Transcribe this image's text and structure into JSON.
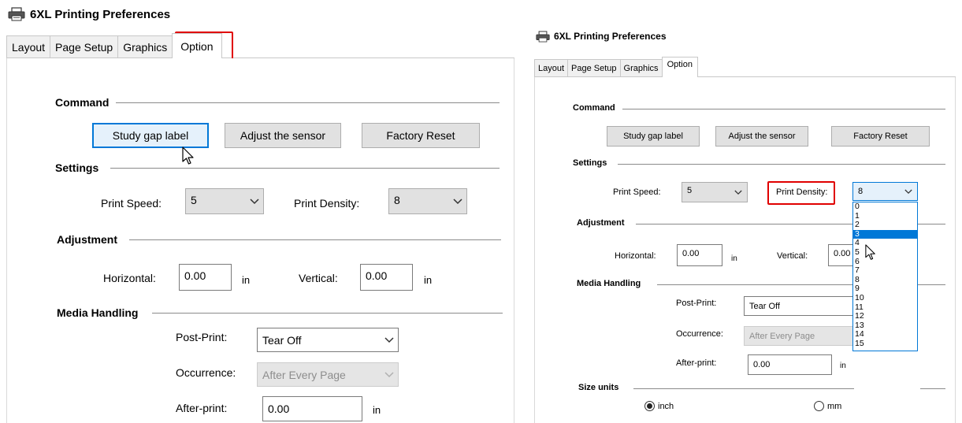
{
  "left_window": {
    "title": "6XL Printing Preferences",
    "tabs": [
      "Layout",
      "Page Setup",
      "Graphics",
      "Option"
    ],
    "active_tab": "Option",
    "command": {
      "section": "Command",
      "study_gap_label": "Study gap label",
      "adjust_sensor": "Adjust the sensor",
      "factory_reset": "Factory Reset"
    },
    "settings": {
      "section": "Settings",
      "print_speed_label": "Print Speed:",
      "print_speed_value": "5",
      "print_density_label": "Print Density:",
      "print_density_value": "8"
    },
    "adjustment": {
      "section": "Adjustment",
      "horizontal_label": "Horizontal:",
      "horizontal_value": "0.00",
      "horizontal_unit": "in",
      "vertical_label": "Vertical:",
      "vertical_value": "0.00",
      "vertical_unit": "in"
    },
    "media": {
      "section": "Media Handling",
      "post_print_label": "Post-Print:",
      "post_print_value": "Tear Off",
      "occurrence_label": "Occurrence:",
      "occurrence_value": "After Every Page",
      "after_print_label": "After-print:",
      "after_print_value": "0.00",
      "after_print_unit": "in"
    }
  },
  "right_window": {
    "title": "6XL Printing Preferences",
    "tabs": [
      "Layout",
      "Page Setup",
      "Graphics",
      "Option"
    ],
    "active_tab": "Option",
    "command": {
      "section": "Command",
      "study_gap_label": "Study gap label",
      "adjust_sensor": "Adjust the sensor",
      "factory_reset": "Factory Reset"
    },
    "settings": {
      "section": "Settings",
      "print_speed_label": "Print Speed:",
      "print_speed_value": "5",
      "print_density_label": "Print Density:",
      "print_density_value": "8",
      "density_options": [
        "0",
        "1",
        "2",
        "3",
        "4",
        "5",
        "6",
        "7",
        "8",
        "9",
        "10",
        "11",
        "12",
        "13",
        "14",
        "15"
      ],
      "highlighted_option": "3"
    },
    "adjustment": {
      "section": "Adjustment",
      "horizontal_label": "Horizontal:",
      "horizontal_value": "0.00",
      "horizontal_unit": "in",
      "vertical_label": "Vertical:",
      "vertical_value": "0.00"
    },
    "media": {
      "section": "Media Handling",
      "post_print_label": "Post-Print:",
      "post_print_value": "Tear Off",
      "occurrence_label": "Occurrence:",
      "occurrence_value": "After Every Page",
      "after_print_label": "After-print:",
      "after_print_value": "0.00",
      "after_print_unit": "in"
    },
    "size_units": {
      "section": "Size units",
      "inch_label": "inch",
      "mm_label": "mm",
      "selected": "inch"
    }
  },
  "colors": {
    "highlight_red": "#e00000",
    "selection_blue": "#0078d7",
    "button_gray": "#e1e1e1"
  },
  "icons": [
    "printer-icon",
    "chevron-down-icon",
    "mouse-cursor-icon"
  ]
}
